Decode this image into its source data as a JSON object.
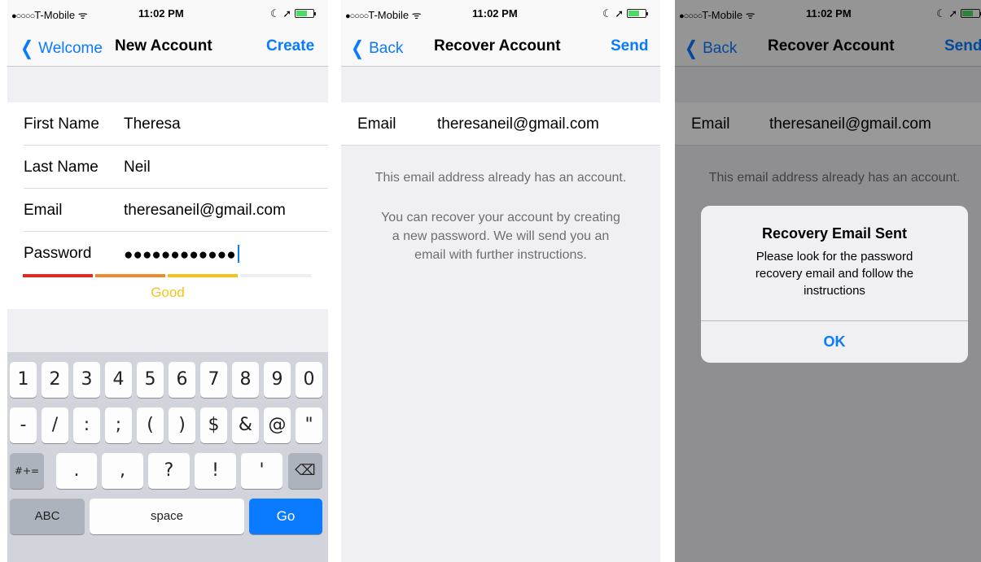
{
  "status": {
    "carrier_dots": "●○○○○",
    "carrier": "T-Mobile",
    "wifi": "ᯤ",
    "time": "11:02 PM",
    "right_icons": "☾ ➚"
  },
  "screen1": {
    "back_label": "Welcome",
    "title": "New Account",
    "action": "Create",
    "fields": [
      {
        "label": "First Name",
        "value": "Theresa"
      },
      {
        "label": "Last Name",
        "value": "Neil"
      },
      {
        "label": "Email",
        "value": "theresaneil@gmail.com"
      },
      {
        "label": "Password",
        "value": "●●●●●●●●●●●●"
      }
    ],
    "strength_label": "Good",
    "strength_level": 0.75,
    "strength_colors": [
      "#e8261f",
      "#f0892a",
      "#f5c21a",
      "#eeeeee"
    ],
    "keyboard": {
      "row1": [
        "1",
        "2",
        "3",
        "4",
        "5",
        "6",
        "7",
        "8",
        "9",
        "0"
      ],
      "row2": [
        "-",
        "/",
        ":",
        ";",
        "(",
        ")",
        "$",
        "&",
        "@",
        "\""
      ],
      "row3_left": "#+=",
      "row3": [
        ".",
        ",",
        "?",
        "!",
        "'"
      ],
      "delete_icon": "⌫",
      "abc": "ABC",
      "space": "space",
      "go": "Go"
    }
  },
  "screen2": {
    "back_label": "Back",
    "title": "Recover Account",
    "action": "Send",
    "email_label": "Email",
    "email_value": "theresaneil@gmail.com",
    "message1": "This email address already has an account.",
    "message2_lines": [
      "You can recover your account by creating",
      "a new password. We will send you an",
      "email with further instructions."
    ]
  },
  "screen3": {
    "back_label": "Back",
    "title": "Recover Account",
    "action": "Send",
    "email_label": "Email",
    "email_value": "theresaneil@gmail.com",
    "message1": "This email address already has an account.",
    "alert": {
      "title": "Recovery Email Sent",
      "message_lines": [
        "Please look for the password",
        "recovery email and follow the",
        "instructions"
      ],
      "ok": "OK"
    }
  },
  "colors": {
    "tint": "#0a7aff",
    "background_gray": "#efeff4",
    "keyboard_gray": "#d1d5db"
  }
}
